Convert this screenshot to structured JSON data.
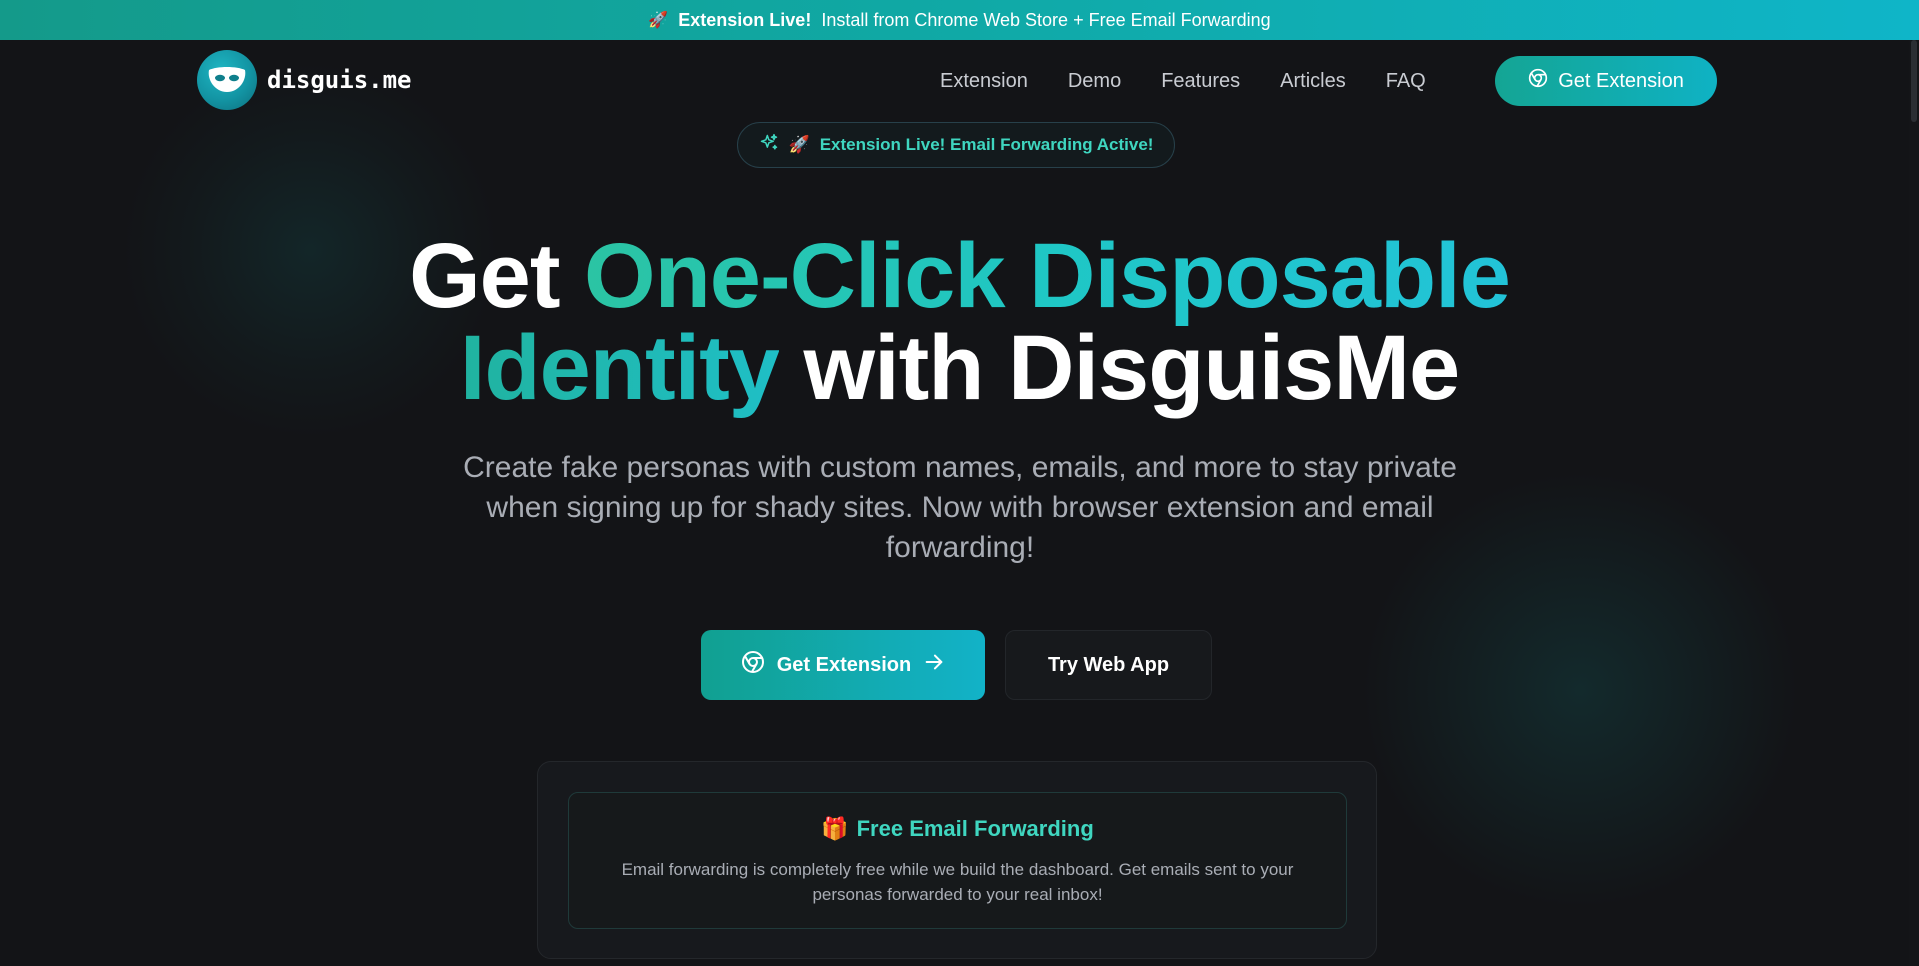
{
  "banner": {
    "emoji": "🚀",
    "strong": "Extension Live!",
    "text": "Install from Chrome Web Store + Free Email Forwarding"
  },
  "nav": {
    "logo_text": "disguis.me",
    "links": [
      "Extension",
      "Demo",
      "Features",
      "Articles",
      "FAQ"
    ],
    "cta_label": "Get Extension"
  },
  "pill": {
    "emoji": "🚀",
    "text": "Extension Live! Email Forwarding Active!"
  },
  "hero": {
    "line1_plain": "Get",
    "line1_grad": "One-Click Disposable",
    "line2_grad": "Identity",
    "line2_plain": "with DisguisMe",
    "subtitle": "Create fake personas with custom names, emails, and more to stay private when signing up for shady sites. Now with browser extension and email forwarding!"
  },
  "buttons": {
    "primary": "Get Extension",
    "secondary": "Try Web App"
  },
  "card": {
    "emoji": "🎁",
    "title": "Free Email Forwarding",
    "body": "Email forwarding is completely free while we build the dashboard. Get emails sent to your personas forwarded to your real inbox!"
  },
  "colors": {
    "background": "#131417",
    "accent": "#14a594",
    "accent_secondary": "#0fb5c8",
    "accent_text": "#3fd6c0"
  },
  "icons": [
    "mask-logo-icon",
    "chrome-icon",
    "sparkle-icon",
    "arrow-right-icon"
  ]
}
